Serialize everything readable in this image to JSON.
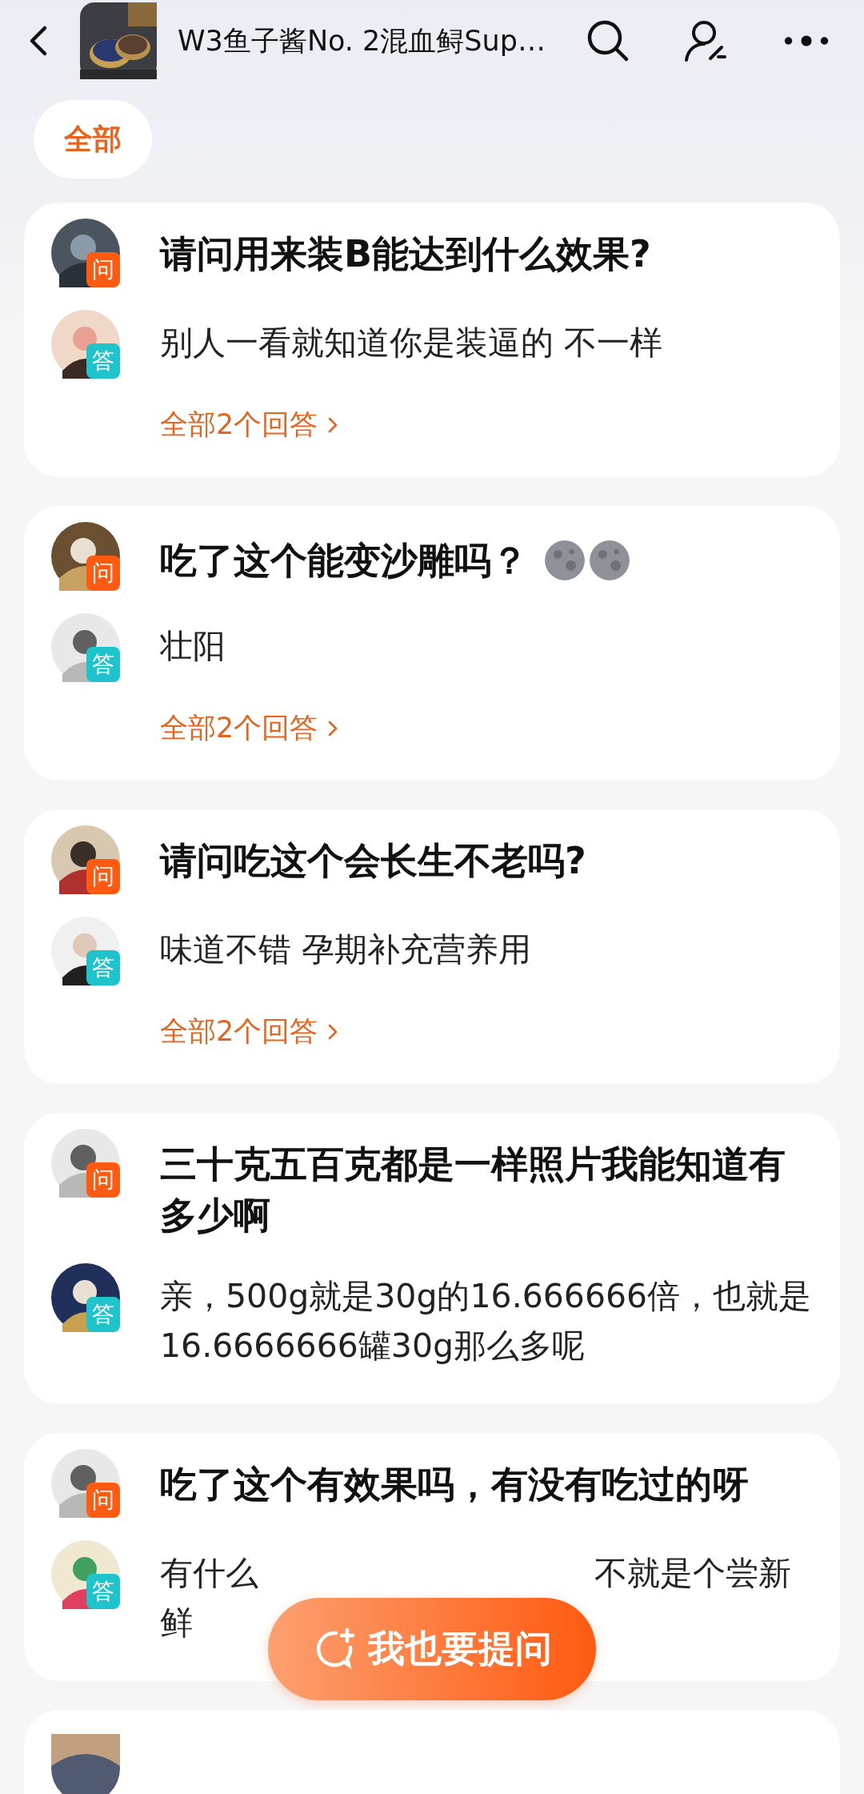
{
  "header": {
    "title": "W3鱼子酱No. 2混血鲟Sup…"
  },
  "tabs": [
    {
      "label": "全部",
      "selected": true
    }
  ],
  "questions": [
    {
      "kind": "full",
      "question": "请问用来装B能达到什么效果?",
      "question_badge": "问",
      "answer": "别人一看就知道你是装逼的 不一样",
      "answer_badge": "答",
      "all_answers_link": "全部2个回答"
    },
    {
      "kind": "full",
      "question": "吃了这个能变沙雕吗？",
      "emojis": [
        {
          "kind": "moon"
        },
        {
          "kind": "moon"
        }
      ],
      "question_badge": "问",
      "answer": "壮阳",
      "answer_badge": "答",
      "all_answers_link": "全部2个回答"
    },
    {
      "kind": "full",
      "question": "请问吃这个会长生不老吗?",
      "question_badge": "问",
      "answer": "味道不错 孕期补充营养用",
      "answer_badge": "答",
      "all_answers_link": "全部2个回答"
    },
    {
      "kind": "full",
      "question": "三十克五百克都是一样照片我能知道有多少啊",
      "question_badge": "问",
      "answer": "亲，500g就是30g的16.666666倍，也就是16.6666666罐30g那么多呢",
      "answer_badge": "答"
    },
    {
      "kind": "full",
      "question": "吃了这个有效果吗，有没有吃过的呀",
      "question_badge": "问",
      "answer_parts": [
        "有什么",
        "不就是个尝新",
        "鲜"
      ],
      "answer_badge": "答"
    },
    {
      "kind": "cut"
    }
  ],
  "ask_button": {
    "label": "我也要提问"
  }
}
